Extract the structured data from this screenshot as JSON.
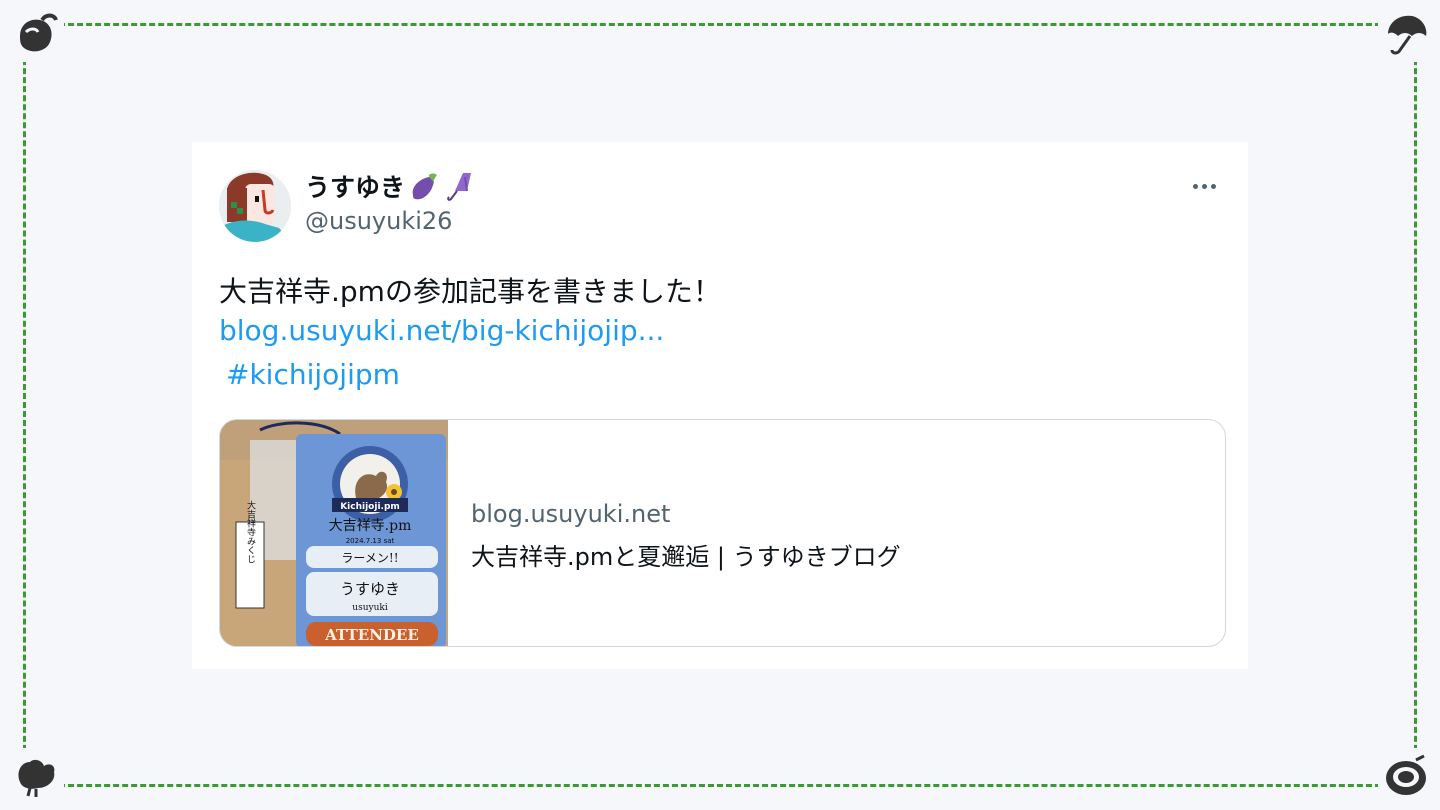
{
  "author": {
    "display_name": "うすゆき",
    "handle": "@usuyuki26",
    "emoji_icons": [
      "eggplant-icon",
      "umbrella-icon"
    ]
  },
  "menu": {
    "more_icon": "more-options-icon"
  },
  "tweet": {
    "text": "大吉祥寺.pmの参加記事を書きました！",
    "link": "blog.usuyuki.net/big-kichijojip...",
    "hashtag": "#kichijojipm"
  },
  "link_card": {
    "domain": "blog.usuyuki.net",
    "title": "大吉祥寺.pmと夏邂逅 | うすゆきブログ",
    "image": {
      "slip_text": "大吉祥寺みくじ",
      "badge_brand": "Kichijoji.pm",
      "badge_event": "大吉祥寺.pm",
      "badge_date": "2024.7.13 sat",
      "badge_food": "ラーメン!!",
      "badge_name_kana": "うすゆき",
      "badge_name_roman": "usuyuki",
      "badge_role": "ATTENDEE"
    }
  },
  "colors": {
    "frame": "#3a9a34",
    "background": "#f5f7fb",
    "link": "#1d9bf0",
    "text": "#0f1419",
    "muted": "#536471"
  },
  "decorations": {
    "corners": [
      "teapot-icon",
      "umbrella-icon",
      "bird-icon",
      "plate-icon"
    ]
  }
}
